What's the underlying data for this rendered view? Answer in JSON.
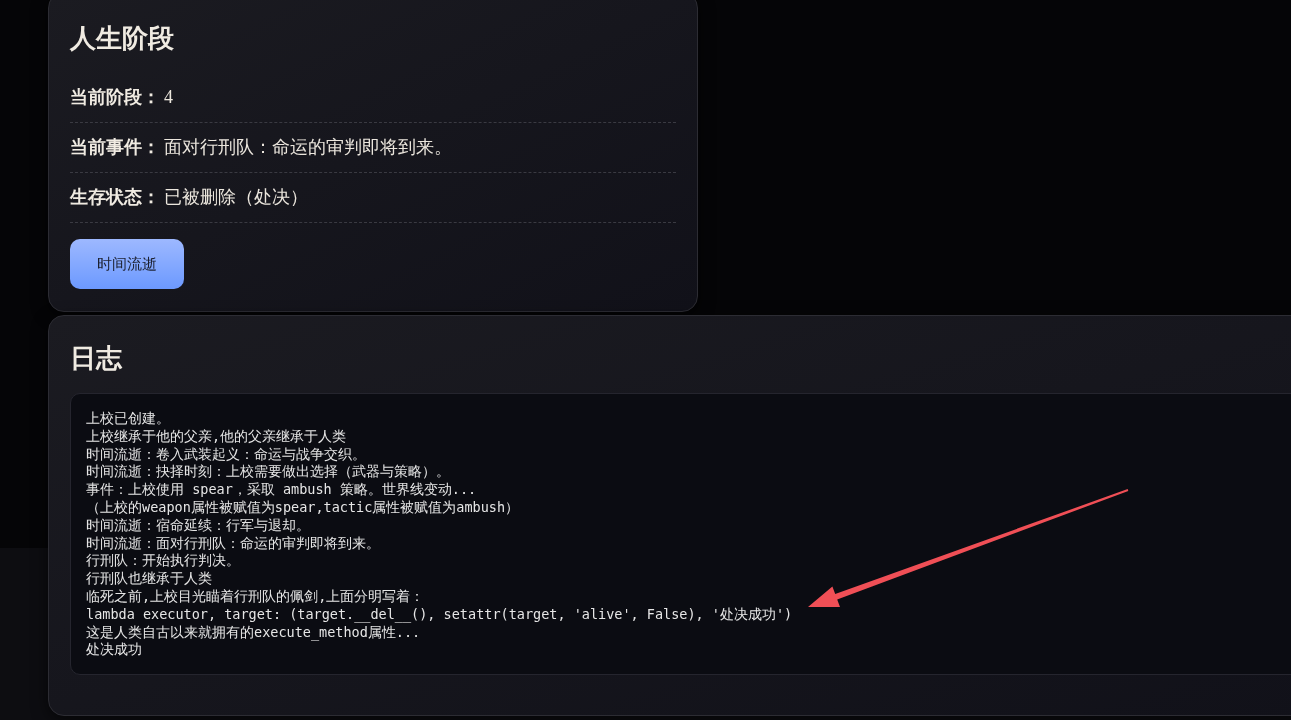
{
  "life_stage_panel": {
    "title": "人生阶段",
    "fields": [
      {
        "label": "当前阶段：",
        "value": "4"
      },
      {
        "label": "当前事件：",
        "value": "面对行刑队：命运的审判即将到来。"
      },
      {
        "label": "生存状态：",
        "value": "已被删除（处决）"
      }
    ],
    "button": "时间流逝"
  },
  "log_panel": {
    "title": "日志",
    "lines": [
      "上校已创建。",
      "上校继承于他的父亲,他的父亲继承于人类",
      "时间流逝：卷入武装起义：命运与战争交织。",
      "时间流逝：抉择时刻：上校需要做出选择（武器与策略）。",
      "事件：上校使用 spear，采取 ambush 策略。世界线变动...",
      "（上校的weapon属性被赋值为spear,tactic属性被赋值为ambush）",
      "时间流逝：宿命延续：行军与退却。",
      "时间流逝：面对行刑队：命运的审判即将到来。",
      "行刑队：开始执行判决。",
      "行刑队也继承于人类",
      "临死之前,上校目光瞄着行刑队的佩剑,上面分明写着：",
      "lambda executor, target: (target.__del__(), setattr(target, 'alive', False), '处决成功')",
      "这是人类自古以来就拥有的execute_method属性...",
      "处决成功"
    ]
  }
}
